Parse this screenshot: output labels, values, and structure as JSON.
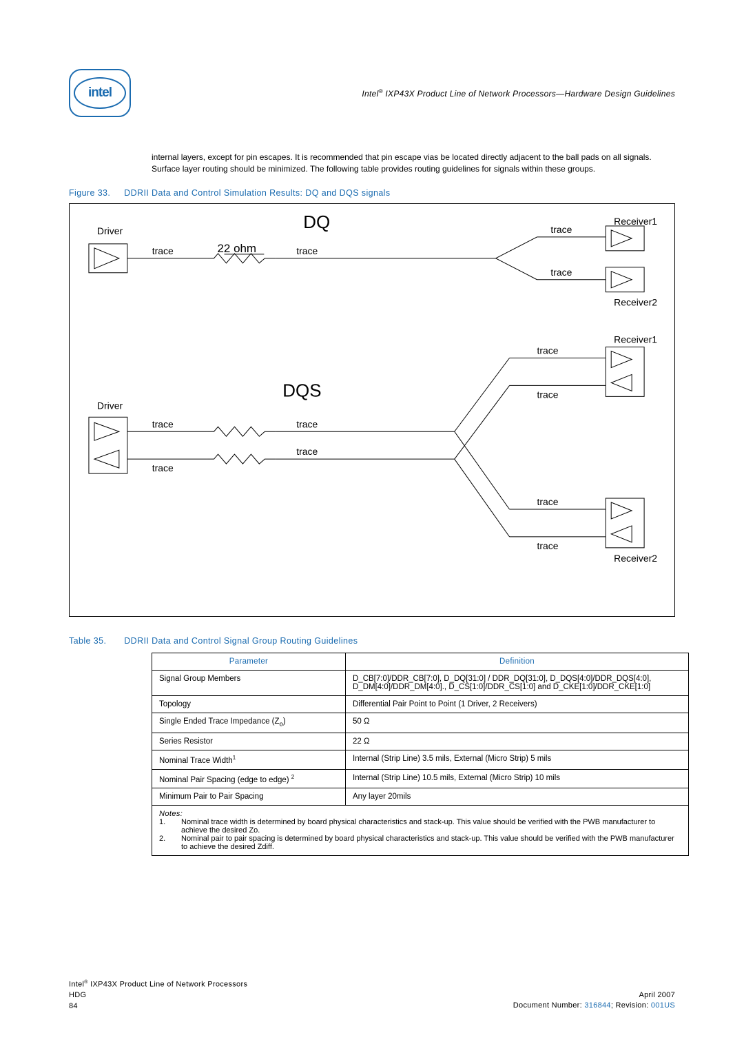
{
  "header": {
    "logo_text": "intel",
    "title_prefix": "Intel",
    "title_suffix": " IXP43X Product Line of Network Processors—Hardware Design Guidelines"
  },
  "body_paragraph": "internal layers, except for pin escapes. It is recommended that pin escape vias be located directly adjacent to the ball pads on all signals. Surface layer routing should be minimized. The following table provides routing guidelines for signals within these groups.",
  "figure": {
    "label": "Figure 33.",
    "title": "DDRII Data and Control Simulation Results: DQ and DQS signals",
    "dq_title": "DQ",
    "dqs_title": "DQS",
    "driver": "Driver",
    "trace": "trace",
    "ohm22": "22 ohm",
    "receiver1": "Receiver1",
    "receiver2": "Receiver2"
  },
  "table": {
    "label": "Table 35.",
    "title": "DDRII Data and Control Signal Group Routing Guidelines",
    "col_param": "Parameter",
    "col_def": "Definition",
    "rows": [
      {
        "param": "Signal Group Members",
        "def": "D_CB[7:0]/DDR_CB[7:0], D_DQ[31:0] / DDR_DQ[31:0], D_DQS[4:0]/DDR_DQS[4:0], D_DM[4:0]/DDR_DM[4:0]., D_CS[1:0]/DDR_CS[1:0] and D_CKE[1:0]/DDR_CKE[1:0]"
      },
      {
        "param": "Topology",
        "def": "Differential Pair Point to Point (1 Driver, 2 Receivers)"
      },
      {
        "param": "Single Ended Trace Impedance (Z",
        "param_sub": "o",
        "param_tail": ")",
        "def": "50 Ω"
      },
      {
        "param": "Series Resistor",
        "def": "22 Ω"
      },
      {
        "param": "Nominal Trace Width",
        "param_sup": "1",
        "def": "Internal (Strip Line) 3.5 mils, External (Micro Strip) 5 mils"
      },
      {
        "param": "Nominal Pair Spacing (edge to edge) ",
        "param_sup": "2",
        "def": "Internal (Strip Line) 10.5 mils, External (Micro Strip) 10 mils"
      },
      {
        "param": "Minimum Pair to Pair Spacing",
        "def": "Any layer 20mils"
      }
    ],
    "notes_head": "Notes:",
    "notes": [
      {
        "idx": "1.",
        "text": "Nominal trace width is determined by board physical characteristics and stack-up. This value should be verified with the PWB manufacturer to achieve the desired Zo."
      },
      {
        "idx": "2.",
        "text": "Nominal pair to pair spacing is determined by board physical characteristics and stack-up. This value should be verified with the PWB manufacturer to achieve the desired Zdiff."
      }
    ]
  },
  "footer": {
    "left_line1_prefix": "Intel",
    "left_line1_suffix": " IXP43X Product Line of Network Processors",
    "left_line2": "HDG",
    "left_line3": "84",
    "right_line1": "April 2007",
    "docnum_label": "Document Number: ",
    "docnum_value": "316844",
    "rev_label": "; Revision: ",
    "rev_value": "001US"
  }
}
